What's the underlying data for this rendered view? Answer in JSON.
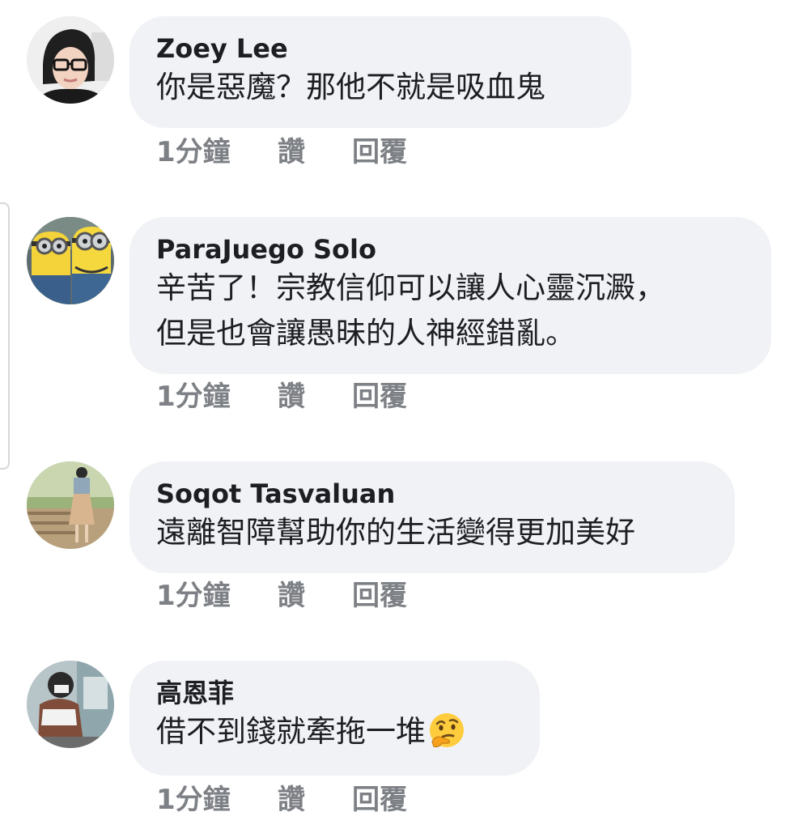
{
  "comments": [
    {
      "author": "Zoey Lee",
      "lines": [
        "你是惡魔？那他不就是吸血鬼"
      ],
      "time": "1分鐘",
      "like": "讚",
      "reply": "回覆"
    },
    {
      "author": "ParaJuego Solo",
      "lines": [
        "辛苦了！宗教信仰可以讓人心靈沉澱，",
        "但是也會讓愚昧的人神經錯亂。"
      ],
      "time": "1分鐘",
      "like": "讚",
      "reply": "回覆"
    },
    {
      "author": "Soqot Tasvaluan",
      "lines": [
        "遠離智障幫助你的生活變得更加美好"
      ],
      "time": "1分鐘",
      "like": "讚",
      "reply": "回覆"
    },
    {
      "author": "高恩菲",
      "lines": [
        "借不到錢就牽拖一堆"
      ],
      "emoji": "thinking-face-emoji",
      "time": "1分鐘",
      "like": "讚",
      "reply": "回覆"
    }
  ],
  "colors": {
    "bubble": "#f0f2f5",
    "text": "#1c1e21",
    "meta": "#7d8085"
  }
}
